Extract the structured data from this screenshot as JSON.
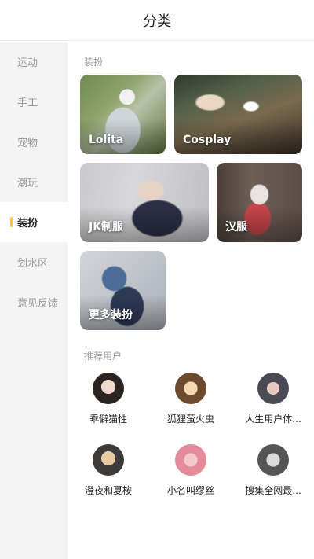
{
  "header": {
    "title": "分类"
  },
  "sidebar": {
    "items": [
      {
        "label": "运动"
      },
      {
        "label": "手工"
      },
      {
        "label": "宠物"
      },
      {
        "label": "潮玩"
      },
      {
        "label": "装扮"
      },
      {
        "label": "划水区"
      },
      {
        "label": "意见反馈"
      }
    ],
    "active_index": 4
  },
  "main": {
    "section_title": "装扮",
    "cards": [
      {
        "label": "Lolita"
      },
      {
        "label": "Cosplay"
      },
      {
        "label": "JK制服"
      },
      {
        "label": "汉服"
      },
      {
        "label": "更多装扮"
      }
    ],
    "recommended_title": "推荐用户",
    "users": [
      {
        "name": "乖僻猫性"
      },
      {
        "name": "狐狸萤火虫"
      },
      {
        "name": "人生用户体..."
      },
      {
        "name": "澄夜和夏桉"
      },
      {
        "name": "小名叫缪丝"
      },
      {
        "name": "搜集全网最..."
      }
    ]
  },
  "colors": {
    "accent": "#ffce1f",
    "sidebar_bg": "#f4f4f4",
    "muted_text": "#9a9a9a"
  }
}
